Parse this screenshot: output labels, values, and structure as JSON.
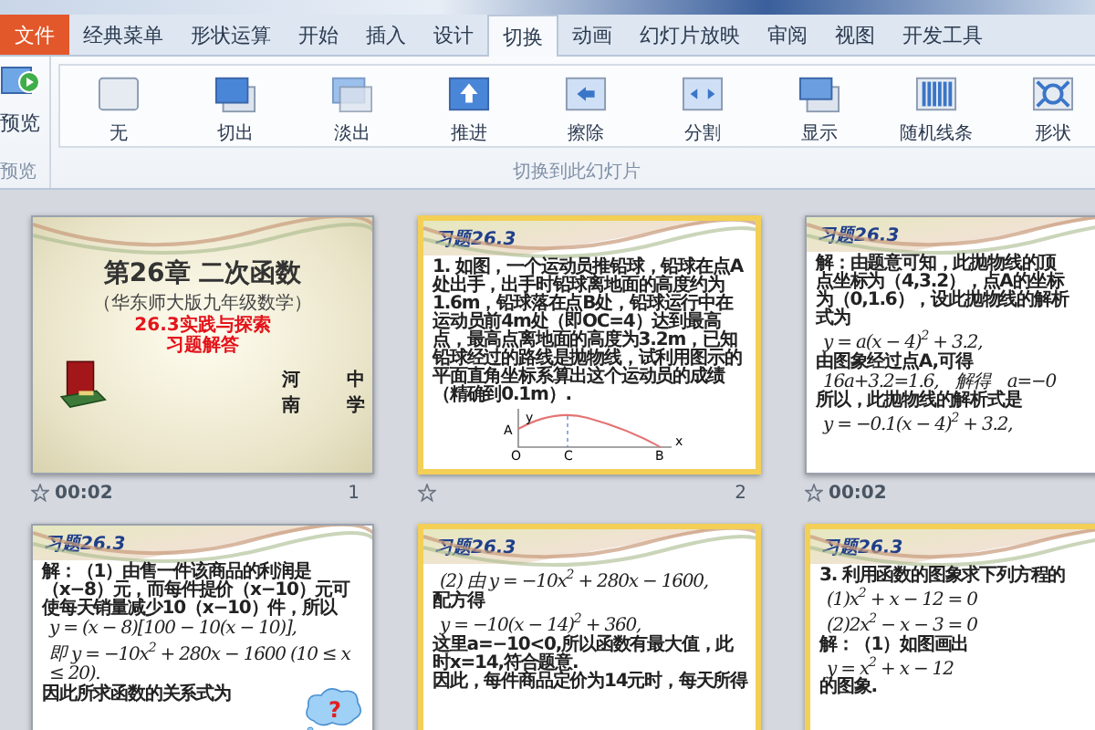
{
  "tabs": [
    {
      "label": "文件",
      "kind": "file",
      "selected": false
    },
    {
      "label": "经典菜单",
      "kind": "tab",
      "selected": false
    },
    {
      "label": "形状运算",
      "kind": "tab",
      "selected": false
    },
    {
      "label": "开始",
      "kind": "tab",
      "selected": false
    },
    {
      "label": "插入",
      "kind": "tab",
      "selected": false
    },
    {
      "label": "设计",
      "kind": "tab",
      "selected": false
    },
    {
      "label": "切换",
      "kind": "tab",
      "selected": true
    },
    {
      "label": "动画",
      "kind": "tab",
      "selected": false
    },
    {
      "label": "幻灯片放映",
      "kind": "tab",
      "selected": false
    },
    {
      "label": "审阅",
      "kind": "tab",
      "selected": false
    },
    {
      "label": "视图",
      "kind": "tab",
      "selected": false
    },
    {
      "label": "开发工具",
      "kind": "tab",
      "selected": false
    }
  ],
  "ribbon": {
    "preview": {
      "button": "预览",
      "group_label": "预览"
    },
    "transitions": [
      "无",
      "切出",
      "淡出",
      "推进",
      "擦除",
      "分割",
      "显示",
      "随机线条",
      "形状"
    ],
    "transitions_group_label": "切换到此幻灯片"
  },
  "slide_rows": [
    {
      "slides": [
        {
          "kind": "cover",
          "selected": false,
          "title": "第26章 二次函数",
          "subtitle": "（华东师大版九年级数学）",
          "red_lines": [
            "26.3实践与探索",
            "习题解答"
          ],
          "footer": [
            "河南",
            "中学"
          ],
          "time": "00:02",
          "number": "1"
        },
        {
          "kind": "content",
          "selected": true,
          "header": "习题26.3",
          "lines": [
            {
              "kind": "text",
              "text": "1. 如图，一个运动员推铅球，铅球在点A处出手，出手时铅球离地面的高度约为1.6m，铅球落在点B处，铅球运行中在运动员前4m处（即OC=4）达到最高点，最高点离地面的高度为3.2m，已知铅球经过的路线是抛物线，试利用图示的平面直角坐标系算出这个运动员的成绩（精确到0.1m）."
            }
          ],
          "figure": {
            "kind": "parabola-down",
            "labels": [
              "y",
              "A",
              "O",
              "C",
              "B",
              "x"
            ]
          },
          "number": "2"
        },
        {
          "kind": "content",
          "selected": false,
          "header": "习题26.3",
          "lines": [
            {
              "kind": "text",
              "text": "解：由题意可知，此抛物线的顶点坐标为（4,3.2），点A的坐标为（0,1.6），设此抛物线的解析式为"
            },
            {
              "kind": "formula",
              "text": "y = a(x − 4)$^{2}$ + 3.2,"
            },
            {
              "kind": "text",
              "text": "由图象经过点A,可得"
            },
            {
              "kind": "formula",
              "text": "16a+3.2=1.6,　解得　a=−0"
            },
            {
              "kind": "text",
              "text": "所以，此抛物线的解析式是"
            },
            {
              "kind": "formula",
              "text": "y = −0.1(x − 4)$^{2}$ + 3.2,"
            }
          ],
          "time": "00:02"
        }
      ]
    },
    {
      "slides": [
        {
          "kind": "content",
          "selected": false,
          "header": "习题26.3",
          "lines": [
            {
              "kind": "text",
              "text": "解：（1）由售一件该商品的利润是（x−8）元，而每件提价（x−10）元可使每天销量减少10（x−10）件，所以"
            },
            {
              "kind": "formula",
              "text": "y = (x − 8)[100 − 10(x − 10)],"
            },
            {
              "kind": "formula",
              "text": "即 y = −10x$^{2}$ + 280x − 1600 (10 ≤ x ≤ 20)."
            },
            {
              "kind": "text",
              "text": "因此所求函数的关系式为"
            }
          ],
          "figure": {
            "kind": "cloud",
            "labels": [
              "?"
            ]
          }
        },
        {
          "kind": "content",
          "selected": true,
          "header": "习题26.3",
          "lines": [
            {
              "kind": "formula",
              "text": "(2) 由 y = −10x$^{2}$ + 280x − 1600,"
            },
            {
              "kind": "text",
              "text": "配方得"
            },
            {
              "kind": "formula",
              "text": "y = −10(x − 14)$^{2}$ + 360,"
            },
            {
              "kind": "text",
              "text": "这里a=−10<0,所以函数有最大值，此时x=14,符合题意."
            },
            {
              "kind": "text",
              "text": "因此，每件商品定价为14元时，每天所得"
            }
          ]
        },
        {
          "kind": "content",
          "selected": true,
          "header": "习题26.3",
          "lines": [
            {
              "kind": "text",
              "text": "3. 利用函数的图象求下列方程的"
            },
            {
              "kind": "formula",
              "text": "(1)x$^{2}$ + x − 12 = 0"
            },
            {
              "kind": "formula",
              "text": "(2)2x$^{2}$ − x − 3 = 0"
            },
            {
              "kind": "text",
              "text": "解：（1）如图画出"
            },
            {
              "kind": "formula",
              "text": "y = x$^{2}$ + x − 12"
            },
            {
              "kind": "text",
              "text": "的图象."
            }
          ]
        }
      ]
    }
  ]
}
